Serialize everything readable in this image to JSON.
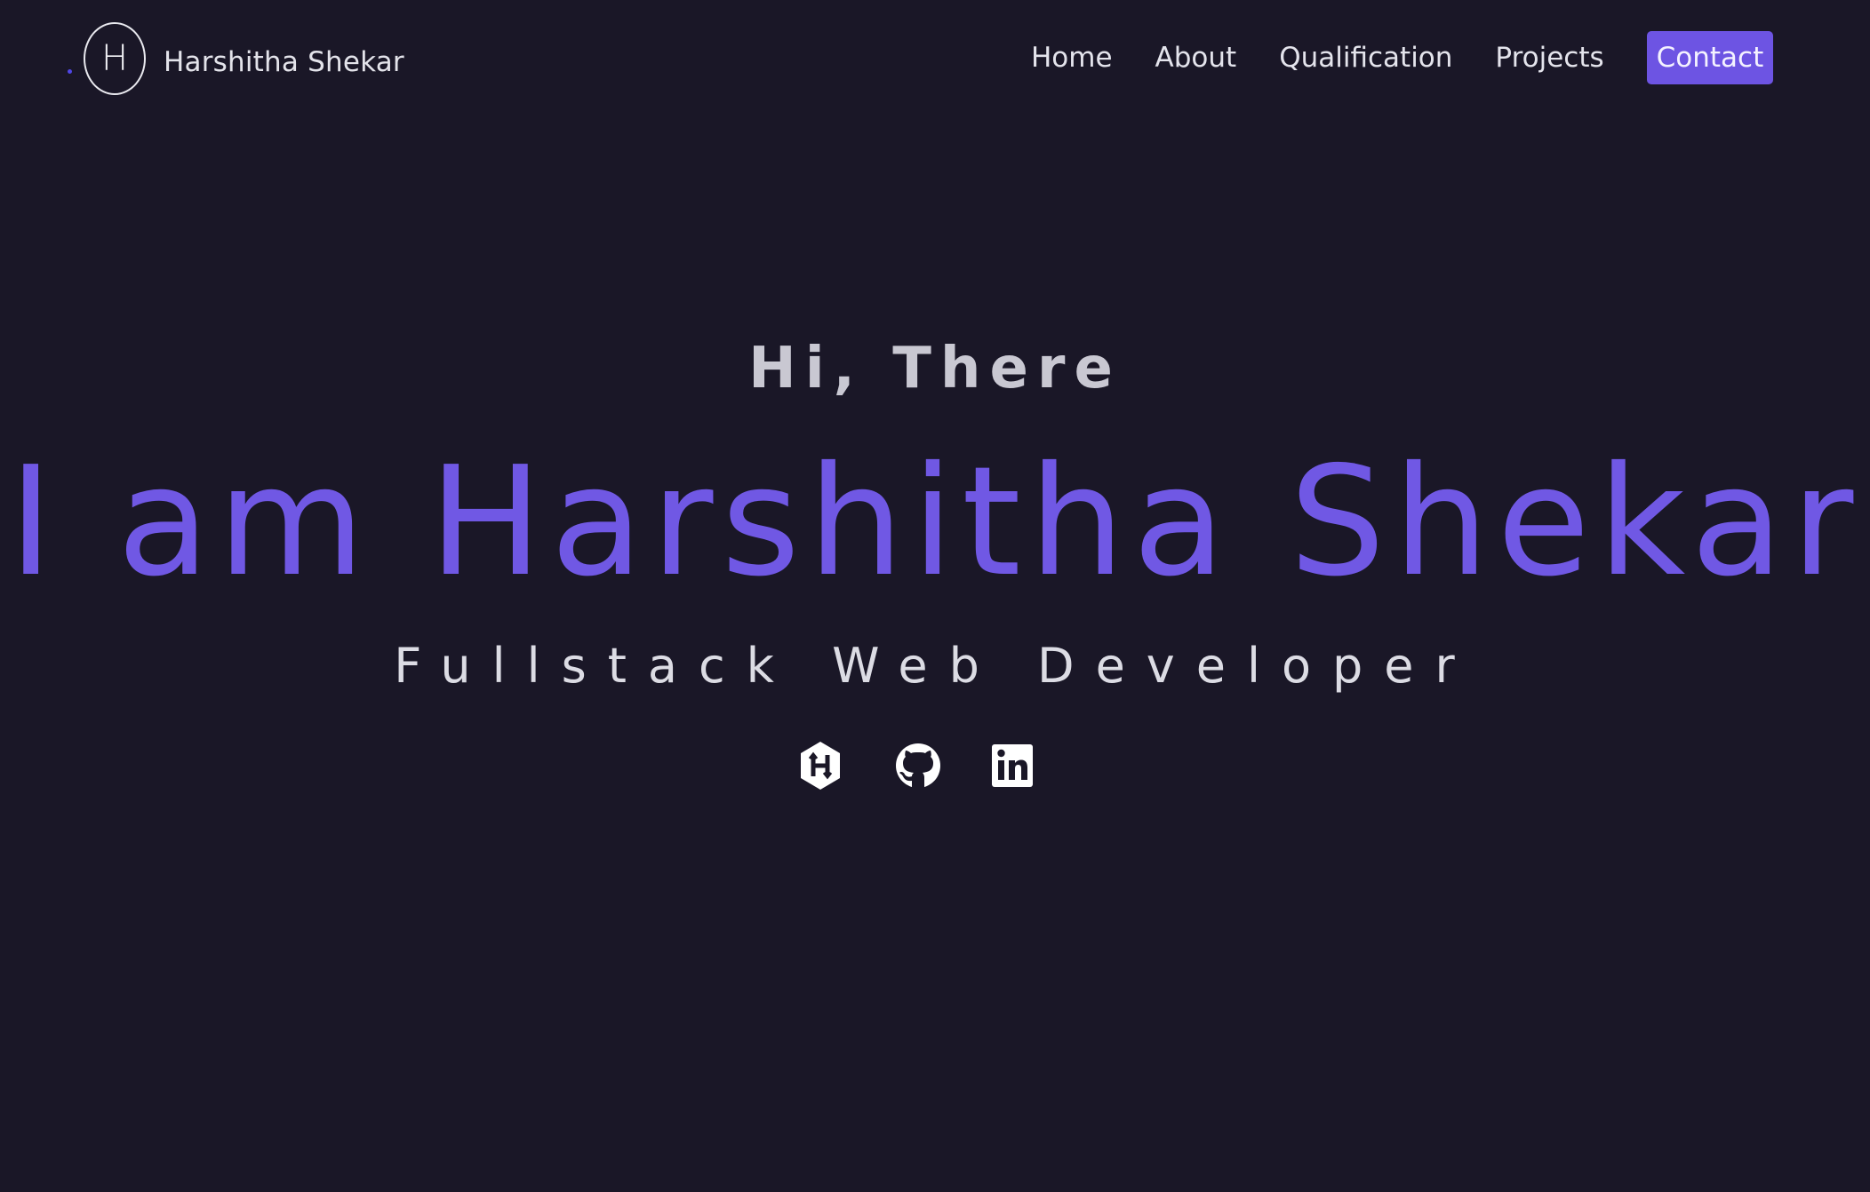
{
  "brand": {
    "logo_letter": "H",
    "name": "Harshitha Shekar"
  },
  "nav": {
    "items": [
      {
        "label": "Home"
      },
      {
        "label": "About"
      },
      {
        "label": "Qualification"
      },
      {
        "label": "Projects"
      }
    ],
    "contact_label": "Contact"
  },
  "hero": {
    "greeting": "Hi, There",
    "headline": "I am Harshitha Shekar",
    "role": "Fullstack Web Developer"
  },
  "social": [
    {
      "icon": "hackerrank-icon"
    },
    {
      "icon": "github-icon"
    },
    {
      "icon": "linkedin-icon"
    }
  ],
  "colors": {
    "background": "#1a1727",
    "accent": "#7058e4",
    "text": "#ececf2"
  }
}
